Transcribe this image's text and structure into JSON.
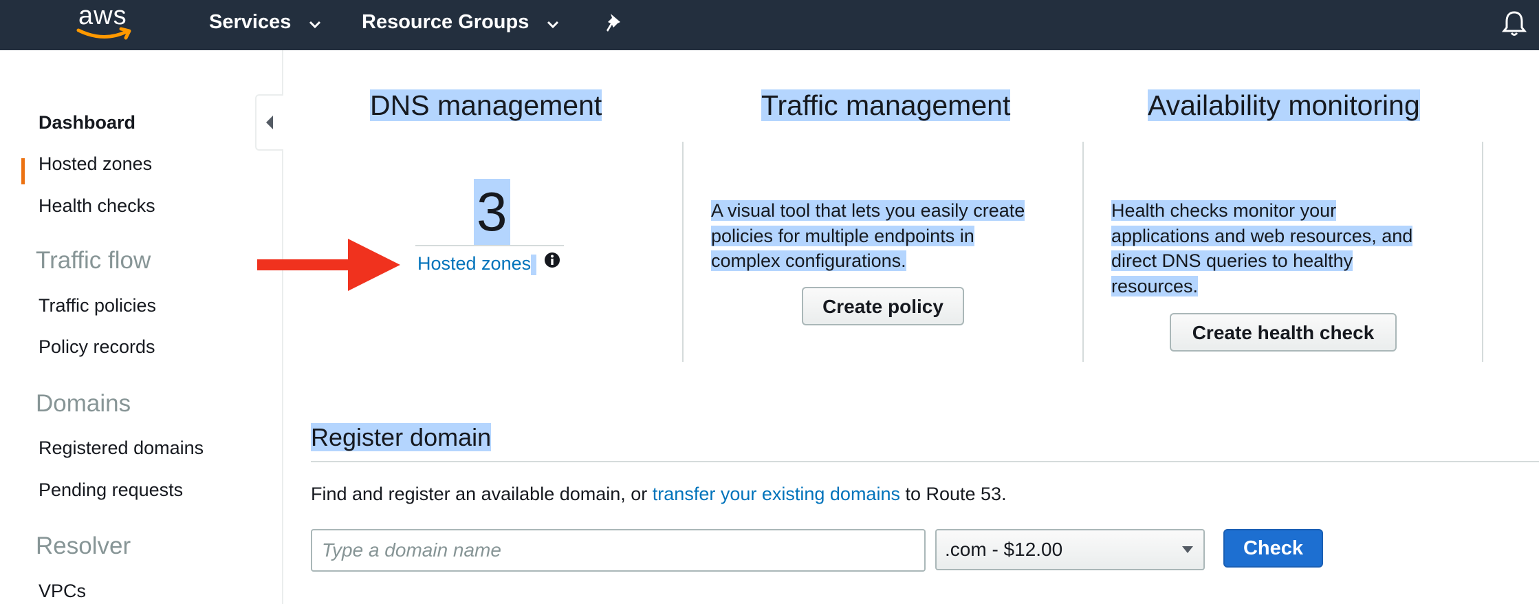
{
  "topnav": {
    "logo_text": "aws",
    "services_label": "Services",
    "resource_groups_label": "Resource Groups",
    "bg_color": "#232f3e",
    "pin_icon": "pin-icon",
    "bell_icon": "bell-icon"
  },
  "sidebar": {
    "items": [
      {
        "label": "Dashboard",
        "active": true
      },
      {
        "label": "Hosted zones"
      },
      {
        "label": "Health checks"
      }
    ],
    "traffic_flow_heading": "Traffic flow",
    "traffic_flow_items": [
      {
        "label": "Traffic policies"
      },
      {
        "label": "Policy records"
      }
    ],
    "domains_heading": "Domains",
    "domains_items": [
      {
        "label": "Registered domains"
      },
      {
        "label": "Pending requests"
      }
    ],
    "resolver_heading": "Resolver",
    "resolver_items": [
      {
        "label": "VPCs"
      }
    ],
    "accent_color": "#ec7211"
  },
  "dns": {
    "title": "DNS management",
    "count": "3",
    "link_label": "Hosted zones"
  },
  "traffic": {
    "title": "Traffic management",
    "desc_lines": [
      "A visual tool that lets you easily create",
      "policies for multiple endpoints in",
      "complex configurations."
    ],
    "button_label": "Create policy"
  },
  "availability": {
    "title": "Availability monitoring",
    "desc_lines": [
      "Health checks monitor your",
      "applications and web resources, and",
      "direct DNS queries to healthy",
      "resources."
    ],
    "button_label": "Create health check"
  },
  "register": {
    "title": "Register domain",
    "text_before": "Find and register an available domain, or ",
    "link_label": "transfer your existing domains",
    "text_after": " to Route 53.",
    "input_placeholder": "Type a domain name",
    "tld_selected": ".com - $12.00",
    "check_label": "Check",
    "link_color": "#0073bb",
    "primary_color": "#1d6fd1"
  },
  "annotation": {
    "arrow_color": "#f0321e"
  }
}
